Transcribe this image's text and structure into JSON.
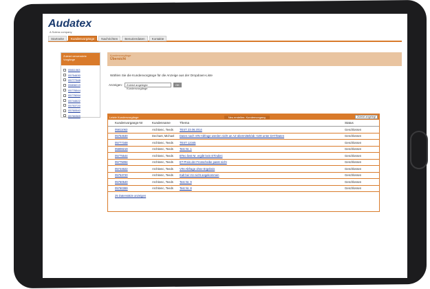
{
  "app": {
    "logo": "Audatex",
    "logo_sub": "A Solera company"
  },
  "nav": {
    "tabs": [
      {
        "label": "Startseite",
        "active": false
      },
      {
        "label": "Kundenvorgänge",
        "active": true
      },
      {
        "label": "Nachrichten",
        "active": false
      },
      {
        "label": "Benutzerdaten",
        "active": false
      },
      {
        "label": "Kontakte",
        "active": false
      }
    ]
  },
  "sidebar": {
    "title": "Zuletzt verwendete Vorgänge",
    "items": [
      "05811063",
      "05754630",
      "05777348",
      "05808219",
      "05775544",
      "05775094",
      "05744622",
      "05753720",
      "05760540",
      "05760369"
    ]
  },
  "main": {
    "breadcrumb": "Kundenvorgänge",
    "title": "Übersicht",
    "instruction": "Wählen Sie die Kundenvorgänge für die Anzeige aus der Dropdown-Liste",
    "filter_label": "Anzeigen:",
    "filter_value": "Zuletzt angelegte Kundenvorgänge",
    "ok_label": "OK"
  },
  "table": {
    "top_left": "Letzte Kundenvorgänge",
    "top_mid": "Neu erstellen: Kundenvorgang",
    "top_select": "Zuletzt angelegt",
    "headers": [
      "Kundenvorgangs-Nr",
      "Kundenname",
      "Thema",
      "Status"
    ],
    "rows": [
      {
        "id": "05811063",
        "name": "Architenc, Teeds",
        "topic": "TEST 23.06.2014",
        "status": "Geschlossen"
      },
      {
        "id": "05754630",
        "name": "Dechant, Michael",
        "topic": "Daten nach VIN-Abfrage werden nicht an AZ übermittelt/ab >100 unter DAT/Daten",
        "status": "Geschlossen"
      },
      {
        "id": "05777348",
        "name": "Architenc, Teeds",
        "topic": "TEST 12345",
        "status": "Geschlossen"
      },
      {
        "id": "05808219",
        "name": "Architenc, Teeds",
        "topic": "Test Nr. 1",
        "status": "Geschlossen"
      },
      {
        "id": "05775544",
        "name": "Architenc, Teeds",
        "topic": "BTeo liest Nr. ergibt kein ETindimi",
        "status": "Geschlossen"
      },
      {
        "id": "05775094",
        "name": "Architenc, Teeds",
        "topic": "ET-Preis der Fronscheibe passt nicht",
        "status": "Geschlossen"
      },
      {
        "id": "05744622",
        "name": "Architenc, Teeds",
        "topic": "VIN-Abfrage ohne Ergebnis",
        "status": "Geschlossen"
      },
      {
        "id": "05753720",
        "name": "Architenc, Teeds",
        "topic": "Kalt bei VU nicht angekommen",
        "status": "Geschlossen"
      },
      {
        "id": "05760540",
        "name": "Architenc, Teeds",
        "topic": "Test Nr. 9",
        "status": "Geschlossen"
      },
      {
        "id": "05760369",
        "name": "Architenc, Teeds",
        "topic": "Test Nr. 8",
        "status": "Geschlossen"
      }
    ],
    "more_link": "25 Datensätze anzeigen"
  },
  "colors": {
    "accent": "#d97a2a",
    "link": "#1a3a9e",
    "bezel": "#1c1c1e"
  }
}
